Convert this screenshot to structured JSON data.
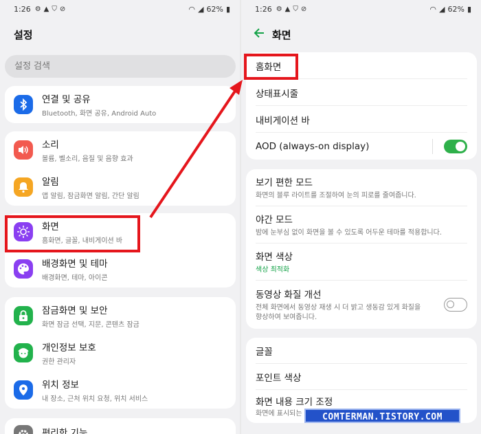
{
  "status": {
    "time": "1:26",
    "battery": "62%"
  },
  "left": {
    "title": "설정",
    "search_placeholder": "설정 검색",
    "items": [
      {
        "title": "연결 및 공유",
        "sub": "Bluetooth, 화면 공유, Android Auto",
        "icon": "bluetooth-icon",
        "color": "#1b6be8"
      },
      {
        "title": "소리",
        "sub": "볼륨, 벨소리, 음질 및 음향 효과",
        "icon": "speaker-icon",
        "color": "#f25a4f"
      },
      {
        "title": "알림",
        "sub": "앱 알림, 잠금화면 알림, 간단 알림",
        "icon": "bell-icon",
        "color": "#f5a623"
      },
      {
        "title": "화면",
        "sub": "홈화면, 글꼴, 내비게이션 바",
        "icon": "display-sun-icon",
        "color": "#8a3ff1"
      },
      {
        "title": "배경화면 및 테마",
        "sub": "배경화면, 테마, 아이콘",
        "icon": "palette-icon",
        "color": "#8a3ff1"
      },
      {
        "title": "잠금화면 및 보안",
        "sub": "화면 잠금 선택, 지문, 콘텐츠 잠금",
        "icon": "lock-icon",
        "color": "#22b24c"
      },
      {
        "title": "개인정보 보호",
        "sub": "권한 관리자",
        "icon": "privacy-face-icon",
        "color": "#22b24c"
      },
      {
        "title": "위치 정보",
        "sub": "내 장소, 근처 위치 요청, 위치 서비스",
        "icon": "location-pin-icon",
        "color": "#1b6be8"
      },
      {
        "title": "편리한 기능",
        "sub": "",
        "icon": "gear-icon",
        "color": "#777777"
      }
    ]
  },
  "right": {
    "title": "화면",
    "items": [
      {
        "title": "홈화면"
      },
      {
        "title": "상태표시줄"
      },
      {
        "title": "내비게이션 바"
      },
      {
        "title": "AOD (always-on display)",
        "toggle": true
      },
      {
        "title": "보기 편한 모드",
        "sub": "화면의 블루 라이트를 조절하여 눈의 피로를 줄여줍니다."
      },
      {
        "title": "야간 모드",
        "sub": "밤에 눈부심 없이 화면을 볼 수 있도록 어두운 테마를 적용합니다."
      },
      {
        "title": "화면 색상",
        "sub": "색상 최적화"
      },
      {
        "title": "동영상 화질 개선",
        "sub": "전체 화면에서 동영상 재생 시 더 밝고 생동감 있게 화질을 향상하여 보여줍니다.",
        "toggle": false
      },
      {
        "title": "글꼴"
      },
      {
        "title": "포인트 색상"
      },
      {
        "title": "화면 내용 크기 조정",
        "sub": "화면에 표시되는"
      }
    ]
  },
  "watermark": "COMTERMAN.TISTORY.COM",
  "colors": {
    "highlight": "#e5161c",
    "toggle_on": "#2eb04a",
    "accent_green": "#13a247"
  }
}
